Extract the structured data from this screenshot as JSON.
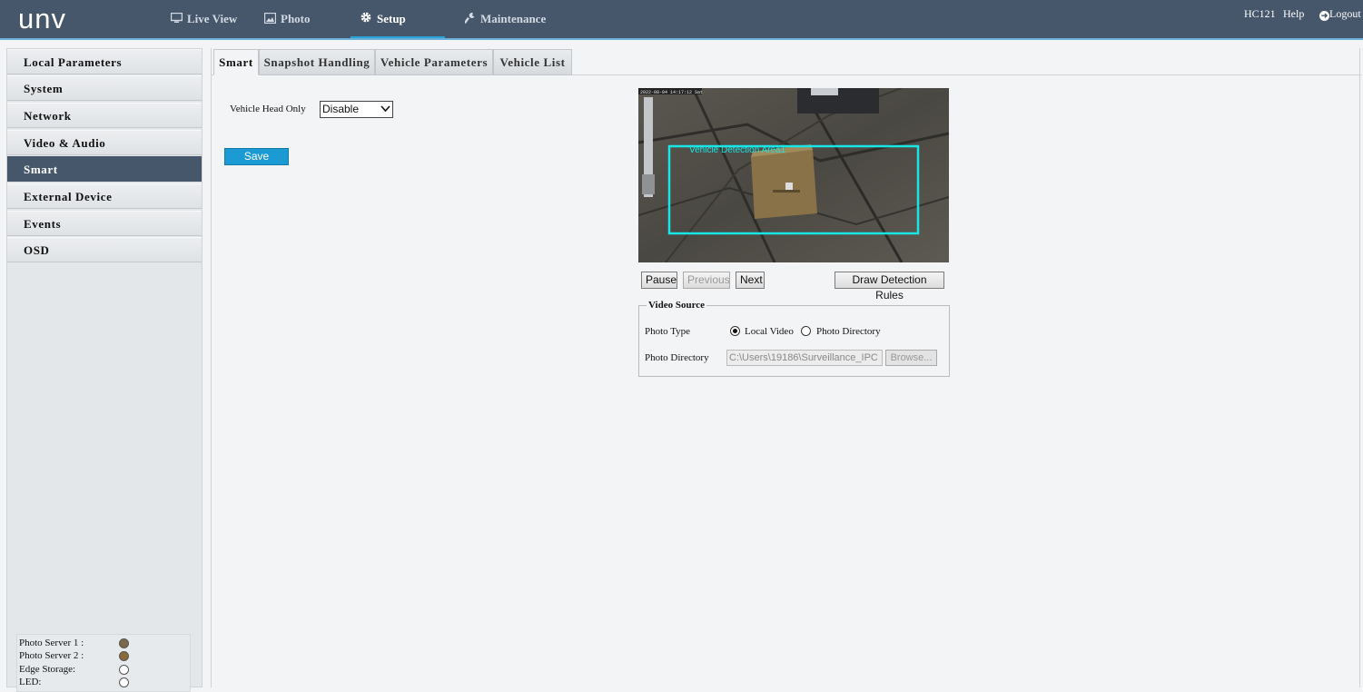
{
  "header": {
    "logo": "unv",
    "nav": [
      {
        "label": "Live View",
        "icon": "monitor-icon"
      },
      {
        "label": "Photo",
        "icon": "photo-icon"
      },
      {
        "label": "Setup",
        "icon": "gear-icon",
        "active": true
      },
      {
        "label": "Maintenance",
        "icon": "wrench-icon"
      }
    ],
    "user": "HC121",
    "help": "Help",
    "logout": "Logout"
  },
  "sidebar": {
    "items": [
      {
        "label": "Local Parameters"
      },
      {
        "label": "System"
      },
      {
        "label": "Network"
      },
      {
        "label": "Video & Audio"
      },
      {
        "label": "Smart",
        "active": true
      },
      {
        "label": "External Device"
      },
      {
        "label": "Events"
      },
      {
        "label": "OSD"
      }
    ],
    "status": [
      {
        "label": "Photo Server 1 :",
        "state": "connected",
        "color": "#7a6a4a"
      },
      {
        "label": "Photo Server 2 :",
        "state": "connected",
        "color": "#8b6a3a"
      },
      {
        "label": "Edge Storage:",
        "state": "off",
        "color": "#ffffff"
      },
      {
        "label": "LED:",
        "state": "off",
        "color": "#ffffff"
      }
    ]
  },
  "tabs": [
    {
      "label": "Smart",
      "active": true
    },
    {
      "label": "Snapshot Handling"
    },
    {
      "label": "Vehicle Parameters"
    },
    {
      "label": "Vehicle List"
    }
  ],
  "form": {
    "vehicle_head_only_label": "Vehicle Head Only",
    "vehicle_head_only_value": "Disable",
    "save_label": "Save"
  },
  "video": {
    "timestamp": "2022-08-04  14:17:12 Sat",
    "area_label": "Vehicle Detection Area1",
    "controls": {
      "pause": "Pause",
      "previous": "Previous",
      "next": "Next",
      "draw_rules": "Draw Detection Rules"
    }
  },
  "video_source": {
    "legend": "Video Source",
    "photo_type_label": "Photo Type",
    "options": [
      "Local Video",
      "Photo Directory"
    ],
    "selected": "Local Video",
    "photo_directory_label": "Photo Directory",
    "photo_directory_value": "C:\\Users\\19186\\Surveillance_IPC",
    "browse_label": "Browse..."
  },
  "colors": {
    "header_bg": "#46566b",
    "accent": "#1b9ad3",
    "detection_box": "#18e6e6"
  }
}
